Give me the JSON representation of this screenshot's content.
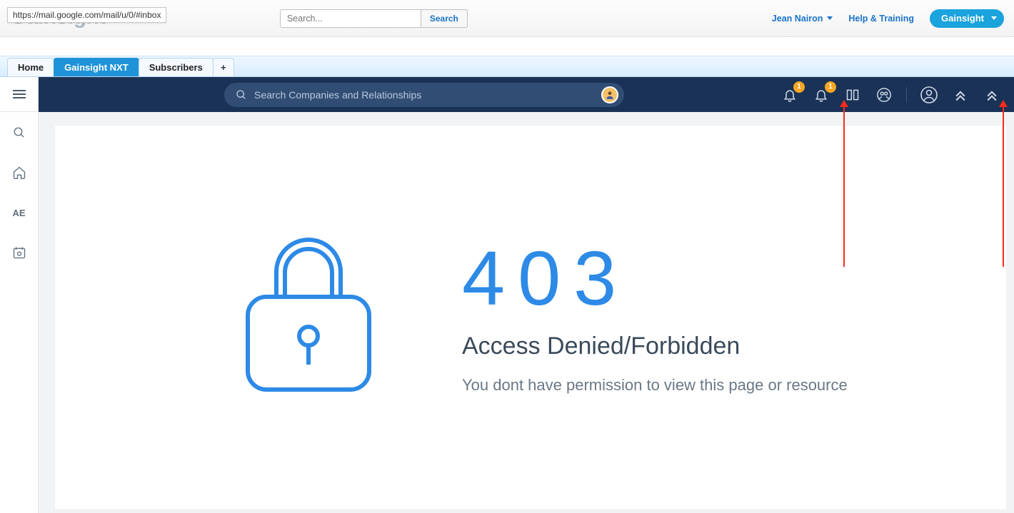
{
  "sf_header": {
    "logo_text": "Gainsight",
    "url_tooltip": "https://mail.google.com/mail/u/0/#inbox",
    "search_placeholder": "Search...",
    "search_button": "Search",
    "user_name": "Jean Nairon",
    "help_link": "Help & Training",
    "app_pill": "Gainsight"
  },
  "tabs": {
    "items": [
      "Home",
      "Gainsight NXT",
      "Subscribers"
    ],
    "active_index": 1,
    "add_label": "+"
  },
  "app_bar": {
    "search_placeholder": "Search Companies and Relationships",
    "notif_badge_1": "1",
    "notif_badge_2": "1"
  },
  "sidebar": {
    "ae_label": "AE"
  },
  "error": {
    "code": "403",
    "title": "Access Denied/Forbidden",
    "subtitle": "You dont have permission to view this page or resource"
  }
}
